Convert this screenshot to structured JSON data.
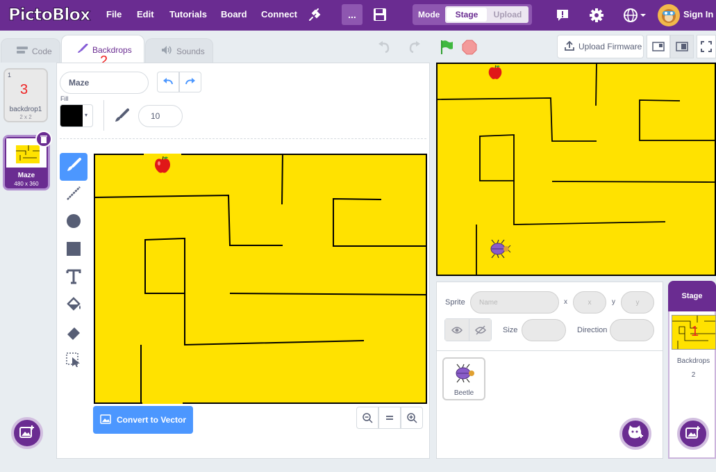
{
  "app": {
    "logo_text": "PictoBlox"
  },
  "menu": {
    "file": "File",
    "edit": "Edit",
    "tutorials": "Tutorials",
    "board": "Board",
    "connect": "Connect",
    "more": "...",
    "sign_in": "Sign In"
  },
  "mode": {
    "label": "Mode",
    "stage": "Stage",
    "upload": "Upload"
  },
  "tabs": {
    "code": "Code",
    "backdrops": "Backdrops",
    "sounds": "Sounds"
  },
  "stage_toolbar": {
    "upload_firmware": "Upload Firmware"
  },
  "backdrop_list": [
    {
      "index": "1",
      "name": "backdrop1",
      "size": "2 x 2"
    },
    {
      "index": "2",
      "name": "Maze",
      "size": "480 x 360"
    }
  ],
  "editor": {
    "costume_name": "Maze",
    "fill_label": "Fill",
    "fill_color": "#000000",
    "brush_size": "10",
    "convert_button": "Convert to Vector"
  },
  "sprite_info": {
    "sprite_label": "Sprite",
    "name_placeholder": "Name",
    "x_label": "x",
    "x_placeholder": "x",
    "y_label": "y",
    "y_placeholder": "y",
    "size_label": "Size",
    "direction_label": "Direction"
  },
  "sprites": [
    {
      "name": "Beetle"
    }
  ],
  "stage_panel": {
    "title": "Stage",
    "backdrops_label": "Backdrops",
    "backdrops_count": "2"
  },
  "annotations": {
    "a1": "1",
    "a2": "2",
    "a3": "3"
  },
  "colors": {
    "topbar": "#6a2c91",
    "maze_yellow": "#ffe200",
    "accent_blue": "#4c97ff"
  }
}
